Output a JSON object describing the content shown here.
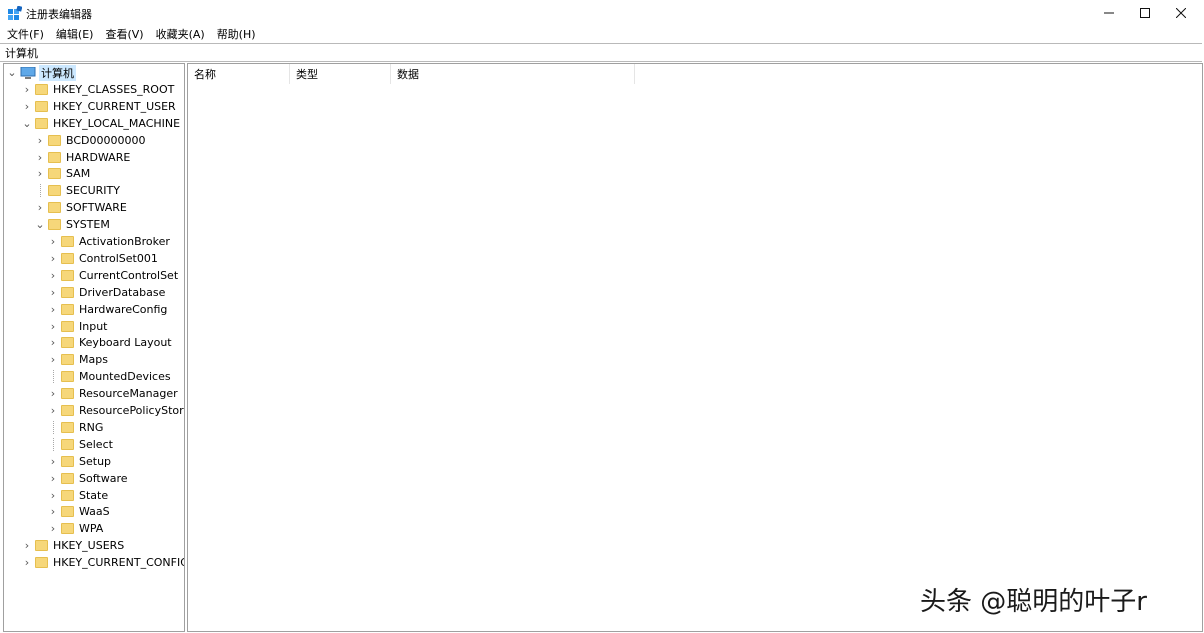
{
  "window": {
    "title": "注册表编辑器"
  },
  "menu": [
    "文件(F)",
    "编辑(E)",
    "查看(V)",
    "收藏夹(A)",
    "帮助(H)"
  ],
  "address": "计算机",
  "tree": {
    "root": "计算机",
    "items": [
      {
        "label": "HKEY_CLASSES_ROOT",
        "level": 1,
        "expander": ">"
      },
      {
        "label": "HKEY_CURRENT_USER",
        "level": 1,
        "expander": ">"
      },
      {
        "label": "HKEY_LOCAL_MACHINE",
        "level": 1,
        "expander": "v"
      },
      {
        "label": "BCD00000000",
        "level": 2,
        "expander": ">"
      },
      {
        "label": "HARDWARE",
        "level": 2,
        "expander": ">"
      },
      {
        "label": "SAM",
        "level": 2,
        "expander": ">"
      },
      {
        "label": "SECURITY",
        "level": 2,
        "expander": ""
      },
      {
        "label": "SOFTWARE",
        "level": 2,
        "expander": ">"
      },
      {
        "label": "SYSTEM",
        "level": 2,
        "expander": "v"
      },
      {
        "label": "ActivationBroker",
        "level": 3,
        "expander": ">"
      },
      {
        "label": "ControlSet001",
        "level": 3,
        "expander": ">"
      },
      {
        "label": "CurrentControlSet",
        "level": 3,
        "expander": ">"
      },
      {
        "label": "DriverDatabase",
        "level": 3,
        "expander": ">"
      },
      {
        "label": "HardwareConfig",
        "level": 3,
        "expander": ">"
      },
      {
        "label": "Input",
        "level": 3,
        "expander": ">"
      },
      {
        "label": "Keyboard Layout",
        "level": 3,
        "expander": ">"
      },
      {
        "label": "Maps",
        "level": 3,
        "expander": ">"
      },
      {
        "label": "MountedDevices",
        "level": 3,
        "expander": ""
      },
      {
        "label": "ResourceManager",
        "level": 3,
        "expander": ">"
      },
      {
        "label": "ResourcePolicyStore",
        "level": 3,
        "expander": ">"
      },
      {
        "label": "RNG",
        "level": 3,
        "expander": ""
      },
      {
        "label": "Select",
        "level": 3,
        "expander": ""
      },
      {
        "label": "Setup",
        "level": 3,
        "expander": ">"
      },
      {
        "label": "Software",
        "level": 3,
        "expander": ">"
      },
      {
        "label": "State",
        "level": 3,
        "expander": ">"
      },
      {
        "label": "WaaS",
        "level": 3,
        "expander": ">"
      },
      {
        "label": "WPA",
        "level": 3,
        "expander": ">"
      },
      {
        "label": "HKEY_USERS",
        "level": 1,
        "expander": ">"
      },
      {
        "label": "HKEY_CURRENT_CONFIG",
        "level": 1,
        "expander": ">"
      }
    ]
  },
  "list": {
    "columns": [
      "名称",
      "类型",
      "数据"
    ]
  },
  "watermark": "头条 @聪明的叶子r",
  "colors": {
    "selection": "#cce8ff",
    "folder": "#f6d77a",
    "border": "#a0a0a0"
  }
}
